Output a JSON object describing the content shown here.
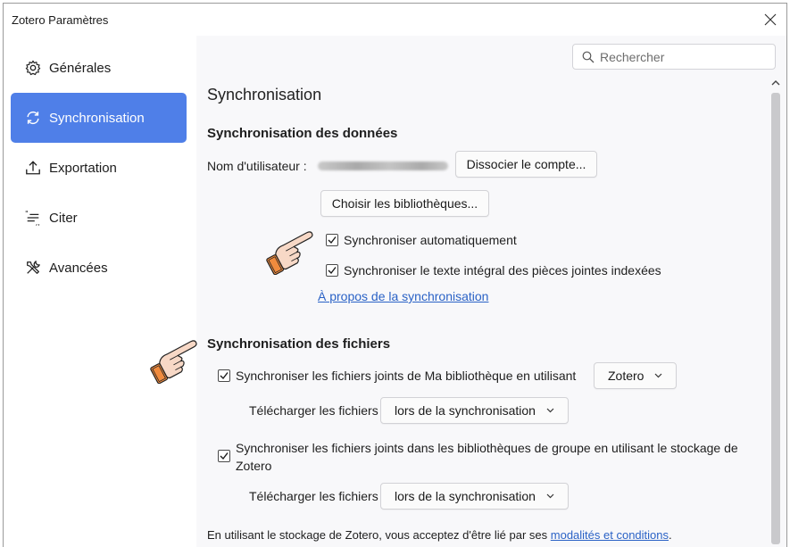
{
  "window": {
    "title": "Zotero Paramètres"
  },
  "sidebar": {
    "items": [
      {
        "label": "Générales",
        "icon": "gear-icon"
      },
      {
        "label": "Synchronisation",
        "icon": "sync-icon",
        "active": true
      },
      {
        "label": "Exportation",
        "icon": "export-icon"
      },
      {
        "label": "Citer",
        "icon": "quote-icon"
      },
      {
        "label": "Avancées",
        "icon": "tools-icon"
      }
    ]
  },
  "search": {
    "placeholder": "Rechercher"
  },
  "sync": {
    "page_title": "Synchronisation",
    "data_section_title": "Synchronisation des données",
    "username_label": "Nom d'utilisateur :",
    "unlink_button": "Dissocier le compte...",
    "choose_libraries_button": "Choisir les bibliothèques...",
    "auto_sync_label": "Synchroniser automatiquement",
    "auto_sync_checked": true,
    "fulltext_sync_label": "Synchroniser le texte intégral des pièces jointes indexées",
    "fulltext_sync_checked": true,
    "about_link": "À propos de la synchronisation"
  },
  "files": {
    "section_title": "Synchronisation des fichiers",
    "my_library_label": "Synchroniser les fichiers joints de Ma bibliothèque en utilisant",
    "my_library_checked": true,
    "my_library_storage": "Zotero",
    "download_label_1": "Télécharger les fichiers",
    "download_value_1": "lors de la synchronisation",
    "group_label_line1": "Synchroniser les fichiers joints dans les bibliothèques de groupe en utilisant le stockage de",
    "group_label_line2": "Zotero",
    "group_checked": true,
    "download_label_2": "Télécharger les fichiers",
    "download_value_2": "lors de la synchronisation"
  },
  "footer": {
    "text": "En utilisant le stockage de Zotero, vous acceptez d'être lié par ses",
    "link": "modalités et conditions",
    "period": "."
  },
  "colors": {
    "accent": "#4f7fe8",
    "link": "#2a62c6",
    "hand_fill": "#f7d8c6",
    "hand_cuff": "#f08b3e"
  }
}
